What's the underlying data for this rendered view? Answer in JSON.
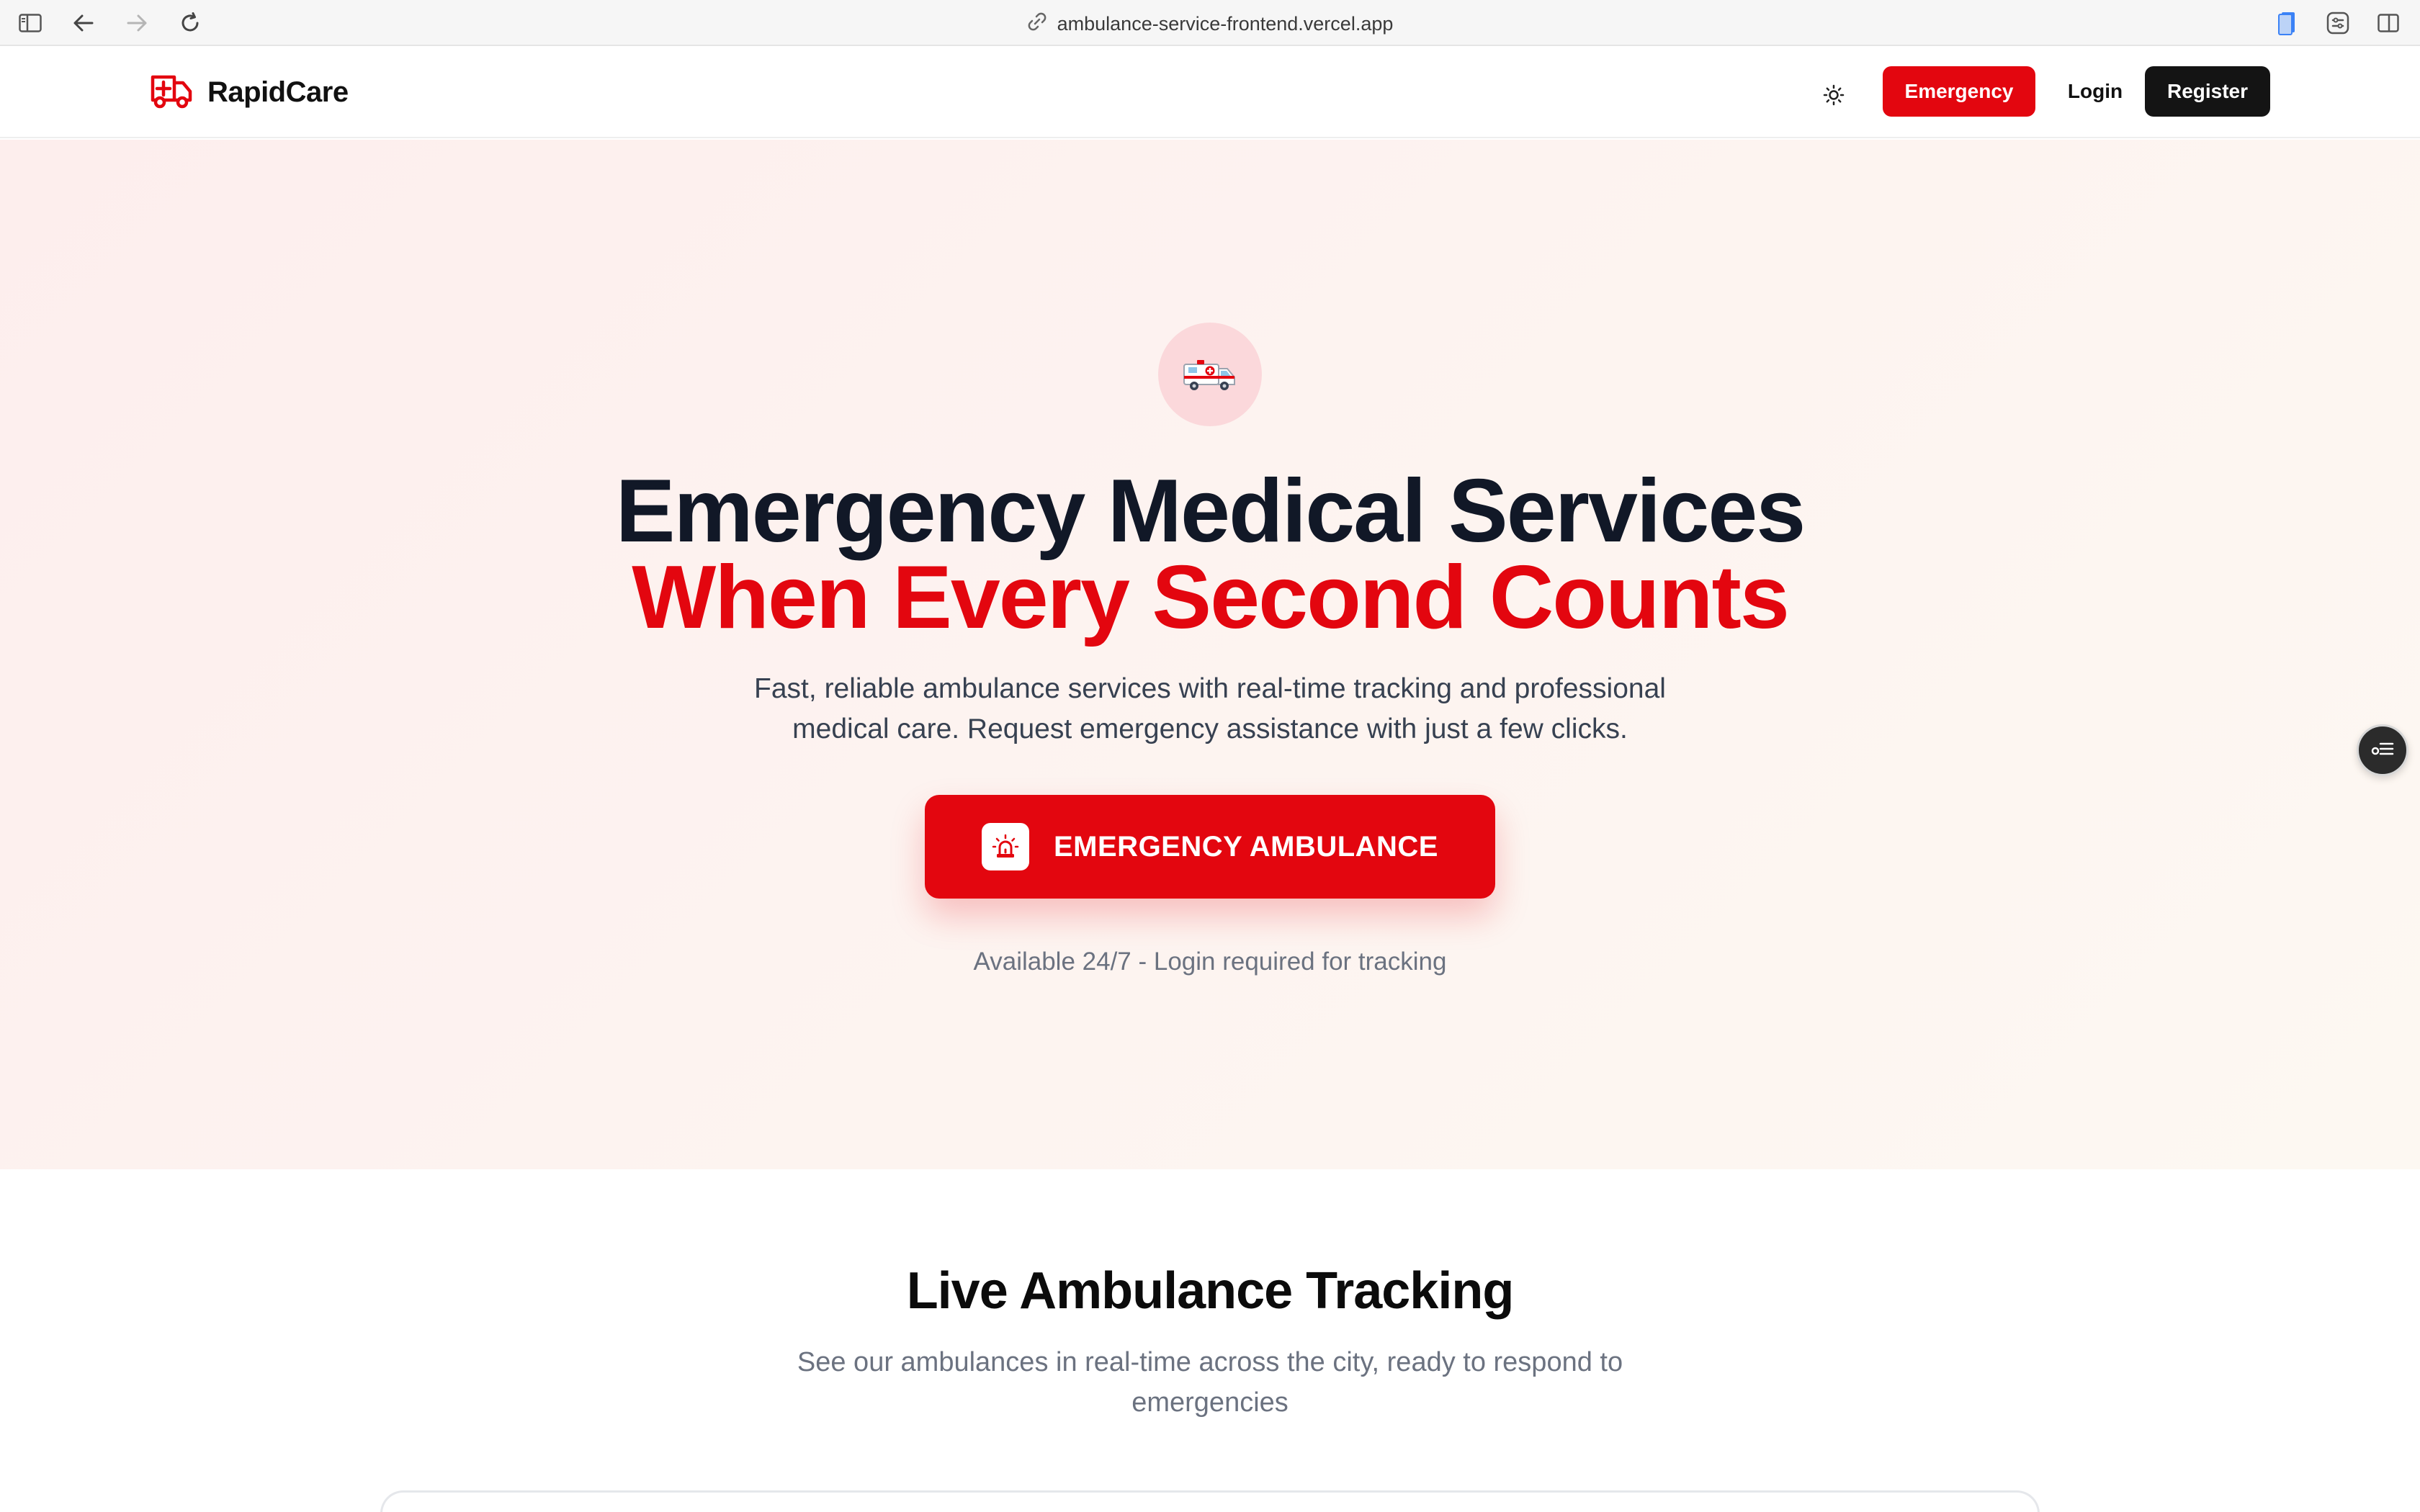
{
  "browser": {
    "url": "ambulance-service-frontend.vercel.app"
  },
  "header": {
    "brand": "RapidCare",
    "emergency_label": "Emergency",
    "login_label": "Login",
    "register_label": "Register",
    "theme_icon": "sun-icon"
  },
  "hero": {
    "title_line1": "Emergency Medical Services",
    "title_line2": "When Every Second Counts",
    "subtitle_line1": "Fast, reliable ambulance services with real-time tracking and professional",
    "subtitle_line2": "medical care. Request emergency assistance with just a few clicks.",
    "cta_label": "EMERGENCY AMBULANCE",
    "note": "Available 24/7 - Login required for tracking",
    "icon": "ambulance-icon"
  },
  "tracking": {
    "title": "Live Ambulance Tracking",
    "subtitle_line1": "See our ambulances in real-time across the city, ready to respond to",
    "subtitle_line2": "emergencies"
  },
  "colors": {
    "accent": "#e3060f",
    "dark": "#141414",
    "hero_bg": "#fdf0ee"
  }
}
